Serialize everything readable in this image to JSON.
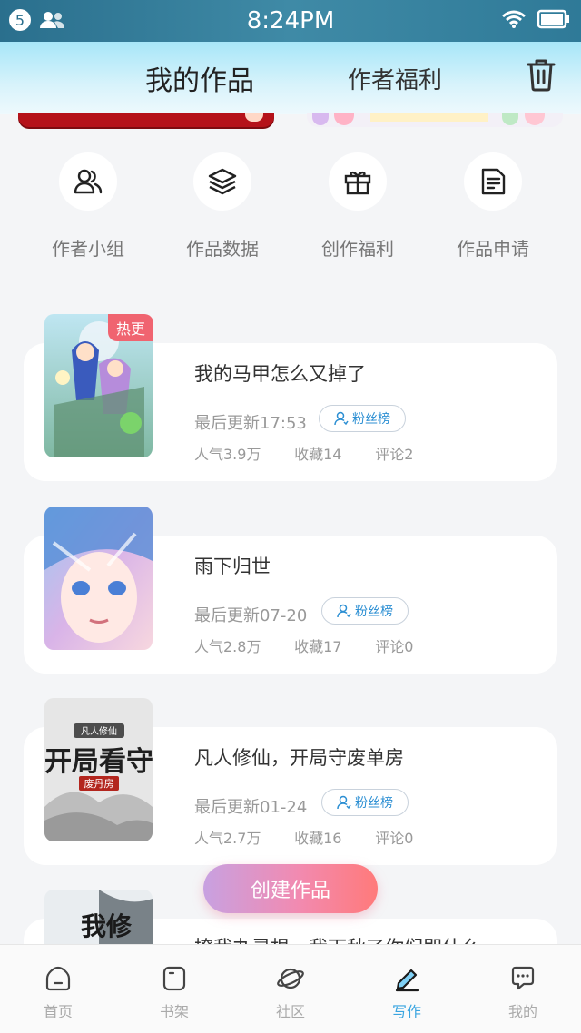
{
  "status_bar": {
    "notification_count": "5",
    "time": "8:24PM"
  },
  "header": {
    "tab_my_works": "我的作品",
    "tab_author_benefits": "作者福利"
  },
  "quick_menu": [
    {
      "label": "作者小组",
      "icon": "people-icon"
    },
    {
      "label": "作品数据",
      "icon": "layers-icon"
    },
    {
      "label": "创作福利",
      "icon": "gift-icon"
    },
    {
      "label": "作品申请",
      "icon": "document-icon"
    }
  ],
  "works": [
    {
      "title": "我的马甲怎么又掉了",
      "updated": "最后更新17:53",
      "fans_label": "粉丝榜",
      "popularity": "人气3.9万",
      "favorites": "收藏14",
      "comments": "评论2",
      "badge": "热更"
    },
    {
      "title": "雨下归世",
      "updated": "最后更新07-20",
      "fans_label": "粉丝榜",
      "popularity": "人气2.8万",
      "favorites": "收藏17",
      "comments": "评论0"
    },
    {
      "title": "凡人修仙，开局守废单房",
      "updated": "最后更新01-24",
      "fans_label": "粉丝榜",
      "popularity": "人气2.7万",
      "favorites": "收藏16",
      "comments": "评论0",
      "cover_text_top": "凡人修仙",
      "cover_text_main": "开局看守",
      "cover_text_sub": "废丹房"
    },
    {
      "title": "撩我办灵根，我下秋了你们即什么",
      "cover_text_main": "我修"
    }
  ],
  "create_button": "创建作品",
  "bottom_nav": [
    {
      "label": "首页",
      "icon": "home-icon",
      "active": false
    },
    {
      "label": "书架",
      "icon": "bookshelf-icon",
      "active": false
    },
    {
      "label": "社区",
      "icon": "planet-icon",
      "active": false
    },
    {
      "label": "写作",
      "icon": "pen-icon",
      "active": true
    },
    {
      "label": "我的",
      "icon": "chat-icon",
      "active": false
    }
  ],
  "colors": {
    "accent_blue": "#3aa5e0",
    "hot_badge": "#f06470",
    "create_gradient_start": "#c8a1e1",
    "create_gradient_end": "#ff7a7a"
  }
}
